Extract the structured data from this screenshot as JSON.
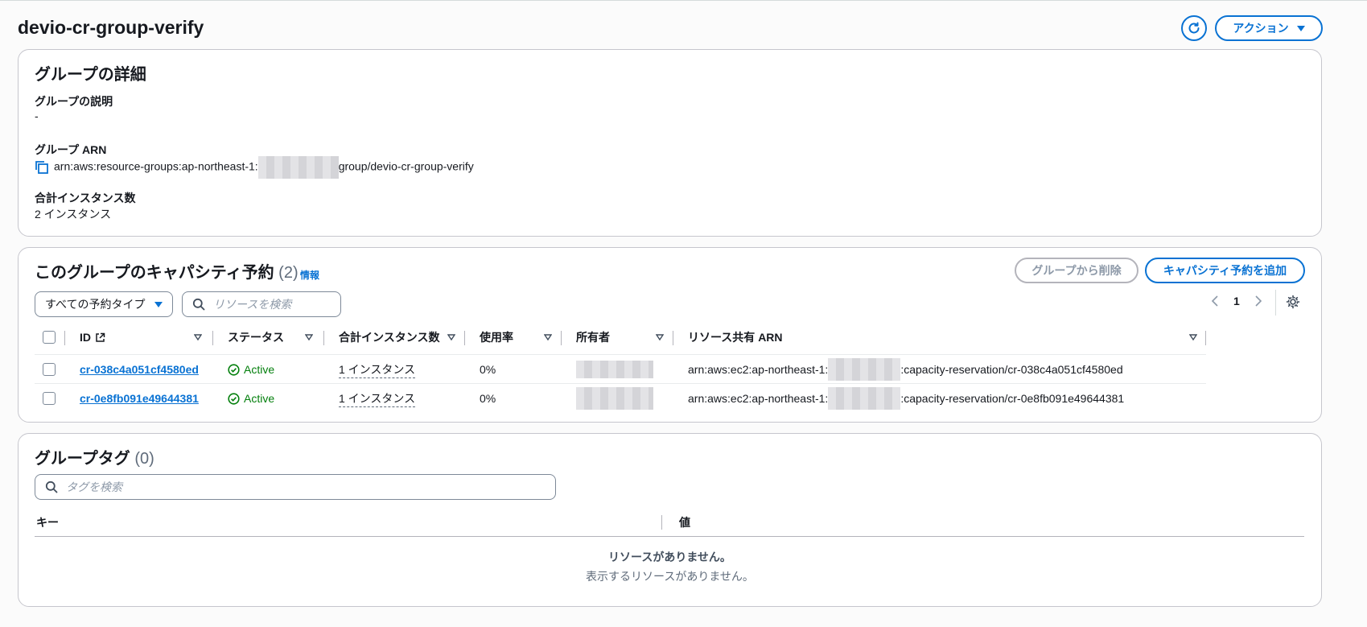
{
  "header": {
    "title": "devio-cr-group-verify",
    "action_label": "アクション"
  },
  "details": {
    "title": "グループの詳細",
    "description_label": "グループの説明",
    "description_value": "-",
    "arn_label": "グループ ARN",
    "arn_prefix": "arn:aws:resource-groups:ap-northeast-1:",
    "arn_suffix": "group/devio-cr-group-verify",
    "total_label": "合計インスタンス数",
    "total_value": "2 インスタンス"
  },
  "capacity": {
    "title": "このグループのキャパシティ予約",
    "count": "(2)",
    "info": "情報",
    "remove_button": "グループから削除",
    "add_button": "キャパシティ予約を追加",
    "filter_select": "すべての予約タイプ",
    "search_placeholder": "リソースを検索",
    "page": "1",
    "columns": [
      "ID",
      "ステータス",
      "合計インスタンス数",
      "使用率",
      "所有者",
      "リソース共有 ARN"
    ],
    "rows": [
      {
        "id": "cr-038c4a051cf4580ed",
        "status": "Active",
        "instances": "1 インスタンス",
        "usage": "0%",
        "arn_prefix": "arn:aws:ec2:ap-northeast-1:",
        "arn_suffix": ":capacity-reservation/cr-038c4a051cf4580ed"
      },
      {
        "id": "cr-0e8fb091e49644381",
        "status": "Active",
        "instances": "1 インスタンス",
        "usage": "0%",
        "arn_prefix": "arn:aws:ec2:ap-northeast-1:",
        "arn_suffix": ":capacity-reservation/cr-0e8fb091e49644381"
      }
    ]
  },
  "tags": {
    "title": "グループタグ",
    "count": "(0)",
    "search_placeholder": "タグを検索",
    "col_key": "キー",
    "col_value": "値",
    "empty_title": "リソースがありません。",
    "empty_sub": "表示するリソースがありません。"
  },
  "colors": {
    "accent": "#0972d3",
    "success": "#037f0c",
    "border": "#c6c6cd"
  }
}
